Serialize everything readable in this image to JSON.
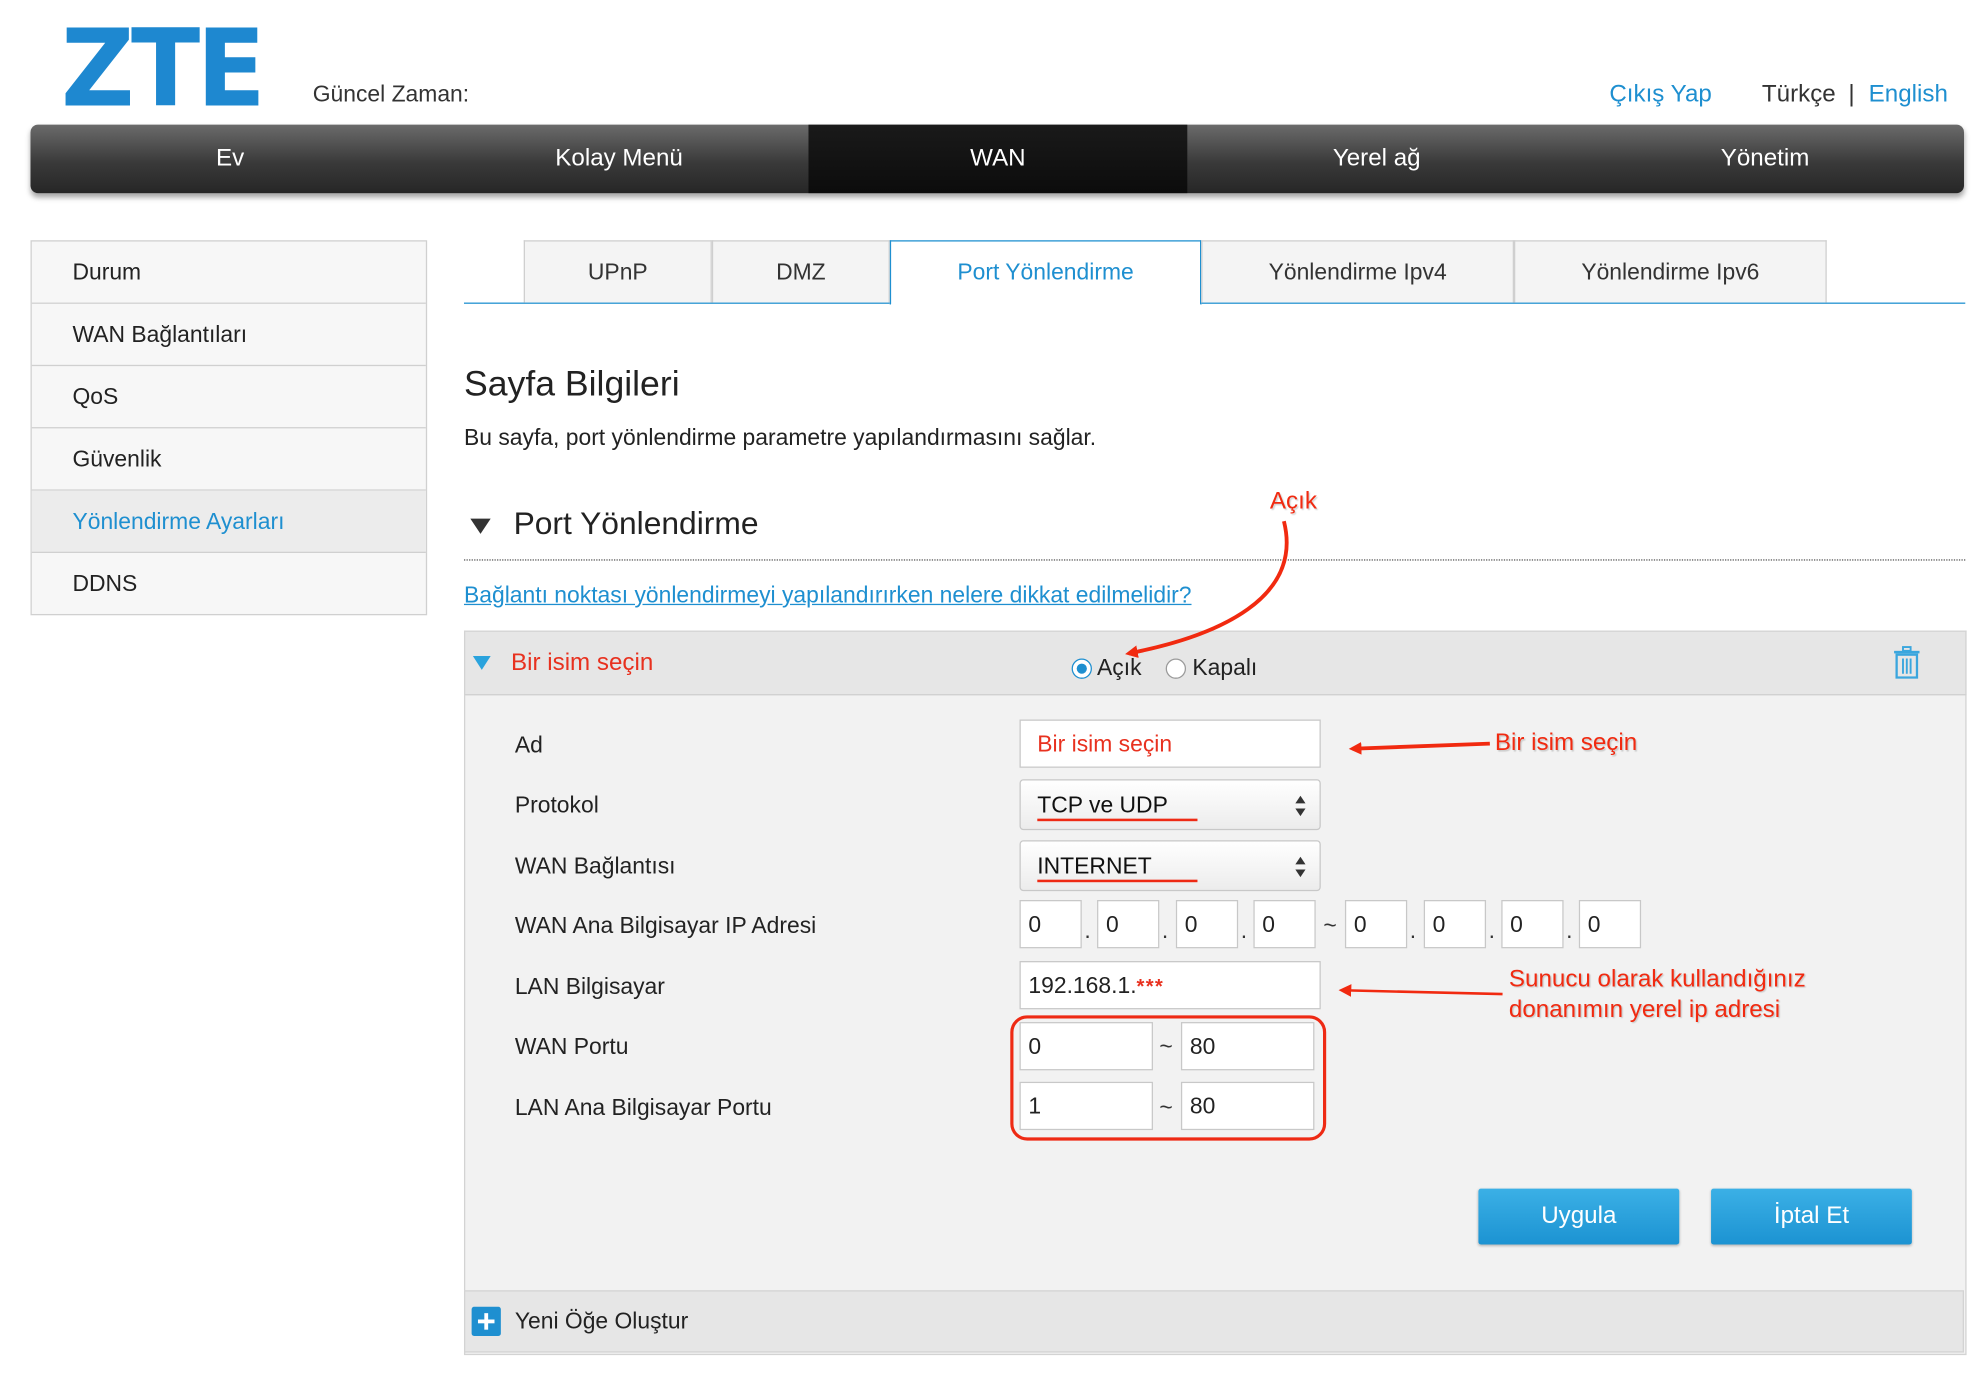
{
  "header": {
    "logo": "ZTE",
    "time_label": "Güncel Zaman:",
    "logout": "Çıkış Yap",
    "lang_tr": "Türkçe",
    "lang_sep": "|",
    "lang_en": "English"
  },
  "nav": [
    "Ev",
    "Kolay Menü",
    "WAN",
    "Yerel ağ",
    "Yönetim"
  ],
  "sidebar": [
    "Durum",
    "WAN Bağlantıları",
    "QoS",
    "Güvenlik",
    "Yönlendirme Ayarları",
    "DDNS"
  ],
  "tabs": [
    "UPnP",
    "DMZ",
    "Port Yönlendirme",
    "Yönlendirme Ipv4",
    "Yönlendirme Ipv6"
  ],
  "page": {
    "title": "Sayfa Bilgileri",
    "desc": "Bu sayfa, port yönlendirme parametre yapılandırmasını sağlar.",
    "section": "Port Yönlendirme",
    "help_link": "Bağlantı noktası yönlendirmeyi yapılandırırken nelere dikkat edilmelidir?"
  },
  "rule": {
    "name": "Bir isim seçin",
    "radio_on": "Açık",
    "radio_off": "Kapalı",
    "labels": {
      "ad": "Ad",
      "protokol": "Protokol",
      "wan_conn": "WAN Bağlantısı",
      "wan_ip": "WAN Ana Bilgisayar IP Adresi",
      "lan_host": "LAN Bilgisayar",
      "wan_port": "WAN Portu",
      "lan_port": "LAN Ana Bilgisayar Portu"
    },
    "ad_value": "Bir isim seçin",
    "protocol": "TCP ve UDP",
    "wan_connection": "INTERNET",
    "wan_ip_start": [
      "0",
      "0",
      "0",
      "0"
    ],
    "wan_ip_end": [
      "0",
      "0",
      "0",
      "0"
    ],
    "ip_sep": ".",
    "range_sep": "~",
    "lan_host_ip": "192.168.1.",
    "lan_host_mask": "***",
    "wan_port_start": "0",
    "wan_port_end": "80",
    "lan_port_start": "1",
    "lan_port_end": "80",
    "apply": "Uygula",
    "cancel": "İptal Et"
  },
  "new_item": "Yeni Öğe Oluştur",
  "annotations": {
    "open": "Açık",
    "name": "Bir isim seçin",
    "server_line1": "Sunucu olarak kullandığınız",
    "server_line2": "donanımın yerel ip adresi"
  },
  "colors": {
    "accent": "#1e8fd0",
    "annotation": "#f12a10",
    "nav_bg": "#3a3a3a"
  }
}
